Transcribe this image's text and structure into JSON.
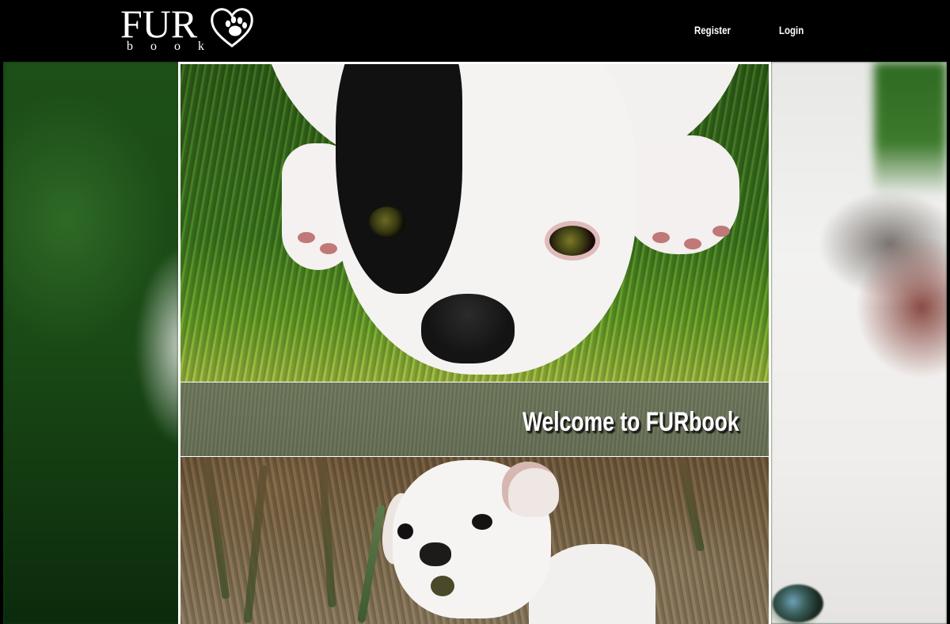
{
  "navbar": {
    "logo": {
      "word": "FUR",
      "sub": "book",
      "icon": "paw-heart-icon"
    },
    "links": {
      "register": "Register",
      "login": "Login"
    }
  },
  "hero": {
    "welcome_text": "Welcome to FURbook"
  },
  "colors": {
    "navbar_bg": "#000000",
    "panel_border": "#ffffff",
    "text": "#ffffff"
  }
}
